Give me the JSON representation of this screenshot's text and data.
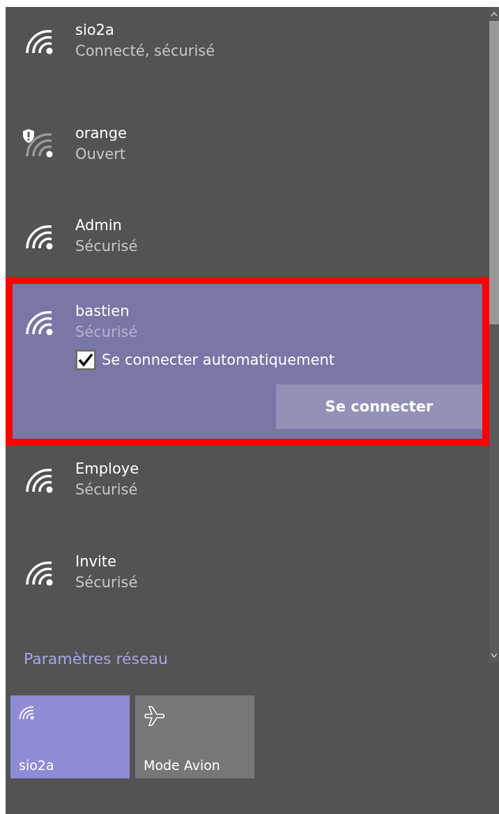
{
  "networks": [
    {
      "name": "sio2a",
      "status": "Connecté, sécurisé",
      "warning": false,
      "expanded": false
    },
    {
      "name": "orange",
      "status": "Ouvert",
      "warning": true,
      "expanded": false
    },
    {
      "name": "Admin",
      "status": "Sécurisé",
      "warning": false,
      "expanded": false
    },
    {
      "name": "bastien",
      "status": "Sécurisé",
      "warning": false,
      "expanded": true,
      "highlighted": true,
      "auto_connect": {
        "label": "Se connecter automatiquement",
        "checked": true
      },
      "connect_button": "Se connecter"
    },
    {
      "name": "Employe",
      "status": "Sécurisé",
      "warning": false,
      "expanded": false
    },
    {
      "name": "Invite",
      "status": "Sécurisé",
      "warning": false,
      "expanded": false
    }
  ],
  "settings_link": "Paramètres réseau",
  "tiles": [
    {
      "kind": "wifi",
      "label": "sio2a",
      "on": true
    },
    {
      "kind": "airplane",
      "label": "Mode Avion",
      "on": false
    }
  ]
}
